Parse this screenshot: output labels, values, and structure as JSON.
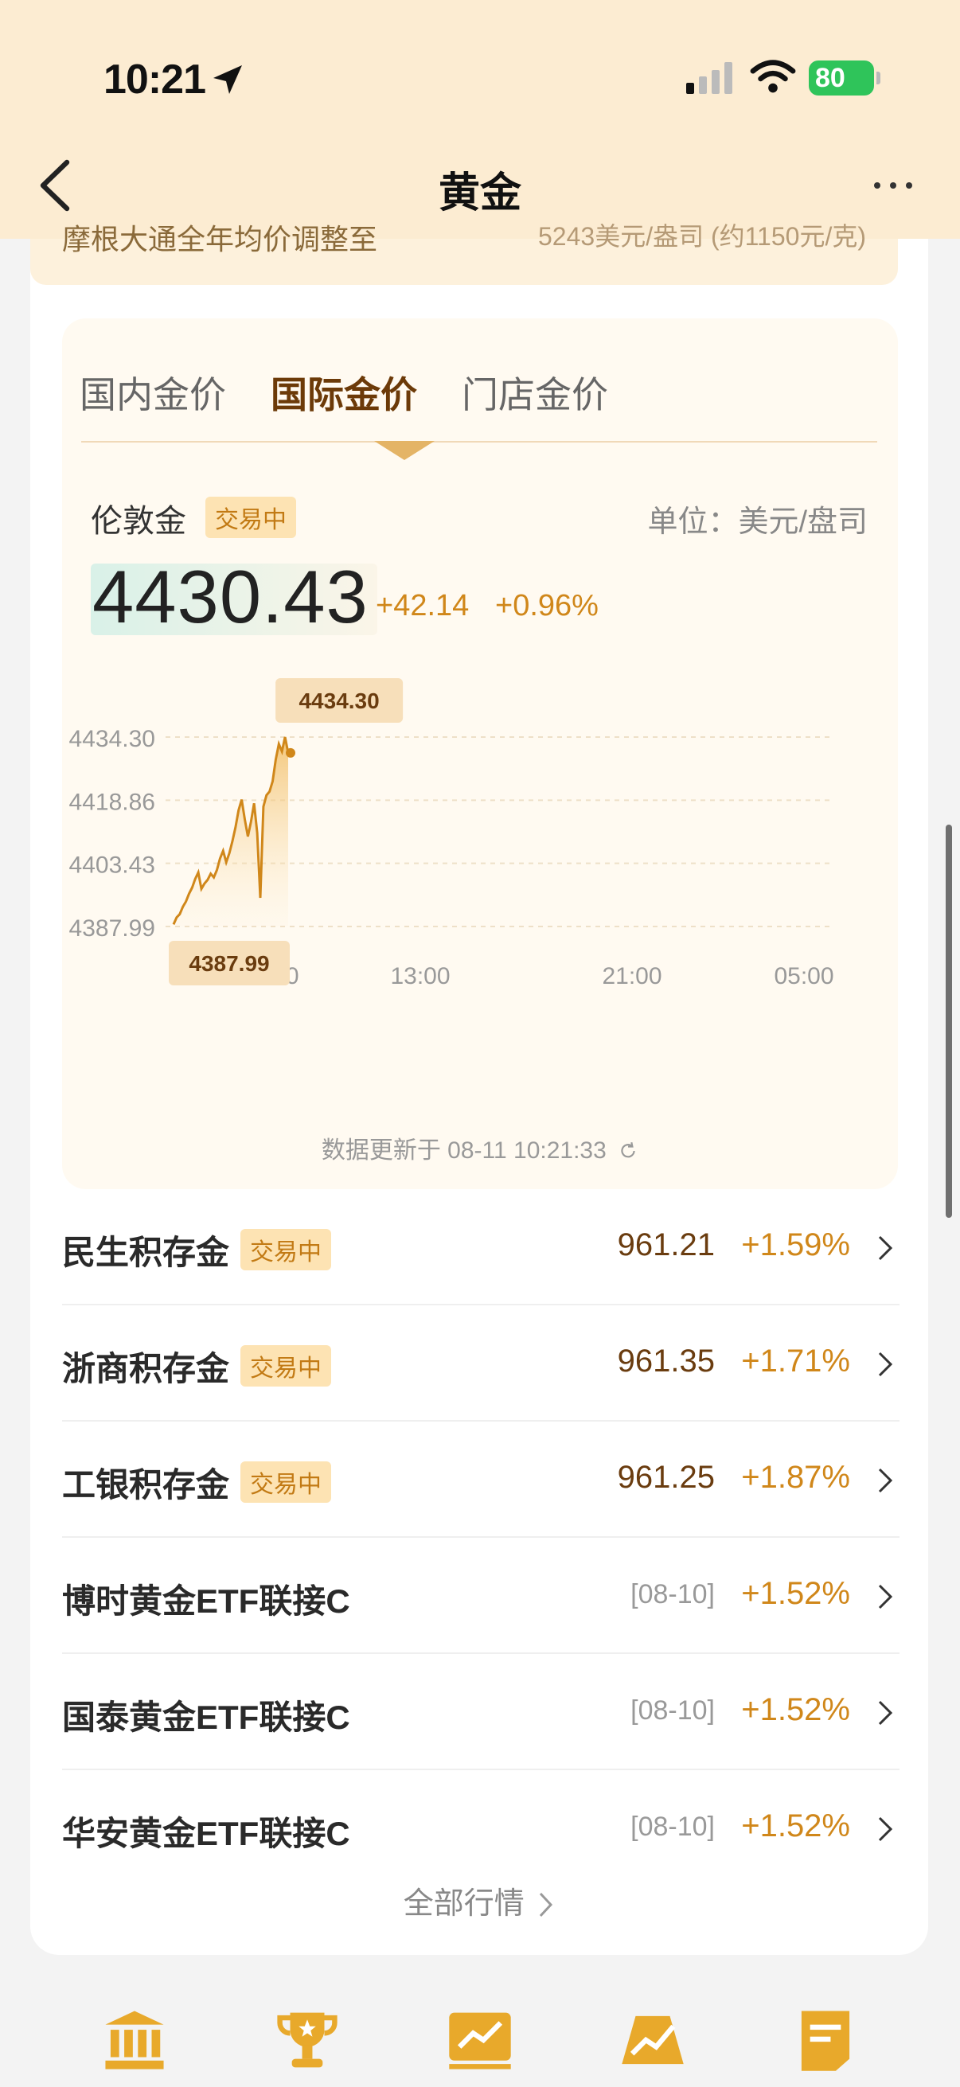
{
  "status": {
    "time": "10:21",
    "battery": "80"
  },
  "header": {
    "title": "黄金"
  },
  "prev_row": {
    "left": "摩根大通全年均价调整至",
    "right": "5243美元/盎司 (约1150元/克)"
  },
  "tabs": [
    "国内金价",
    "国际金价",
    "门店金价"
  ],
  "metal": {
    "name": "伦敦金",
    "badge": "交易中",
    "unit": "单位：美元/盘司",
    "price": "4430.43",
    "change": "+42.14",
    "pct": "+0.96%"
  },
  "chart_data": {
    "type": "line",
    "y_ticks": [
      "4434.30",
      "4418.86",
      "4403.43",
      "4387.99"
    ],
    "x_ticks": [
      "06:00",
      "13:00",
      "21:00",
      "05:00"
    ],
    "ylim": [
      4387.99,
      4434.3
    ],
    "high_label": "4434.30",
    "low_label": "4387.99",
    "series": [
      {
        "values": [
          4388.5,
          4390.2,
          4391.0,
          4392.8,
          4394.1,
          4396.0,
          4397.5,
          4399.6,
          4401.2,
          4397.2,
          4398.5,
          4399.4,
          4400.9,
          4400.0,
          4401.8,
          4404.6,
          4406.5,
          4403.7,
          4405.9,
          4408.8,
          4412.2,
          4416.4,
          4419.0,
          4414.2,
          4410.0,
          4413.6,
          4418.1,
          4410.9,
          4395.0,
          4417.3,
          4420.1,
          4421.0,
          4423.5,
          4428.8,
          4432.6,
          4430.8,
          4434.3,
          4430.43
        ]
      }
    ]
  },
  "updated": "数据更新于 08-11 10:21:33",
  "rows": [
    {
      "name": "民生积存金",
      "badge": "交易中",
      "price": "961.21",
      "date": "",
      "pct": "+1.59%"
    },
    {
      "name": "浙商积存金",
      "badge": "交易中",
      "price": "961.35",
      "date": "",
      "pct": "+1.71%"
    },
    {
      "name": "工银积存金",
      "badge": "交易中",
      "price": "961.25",
      "date": "",
      "pct": "+1.87%"
    },
    {
      "name": "博时黄金ETF联接C",
      "badge": "",
      "price": "",
      "date": "[08-10]",
      "pct": "+1.52%"
    },
    {
      "name": "国泰黄金ETF联接C",
      "badge": "",
      "price": "",
      "date": "[08-10]",
      "pct": "+1.52%"
    },
    {
      "name": "华安黄金ETF联接C",
      "badge": "",
      "price": "",
      "date": "[08-10]",
      "pct": "+1.52%"
    }
  ],
  "all_link": "全部行情",
  "bottom_tabs": [
    "bank-icon",
    "trophy-icon",
    "chart-icon",
    "trend-icon",
    "note-icon"
  ],
  "colors": {
    "gold": "#d0871a",
    "brown": "#6a3c0f",
    "header_bg": "#fcecd2"
  }
}
